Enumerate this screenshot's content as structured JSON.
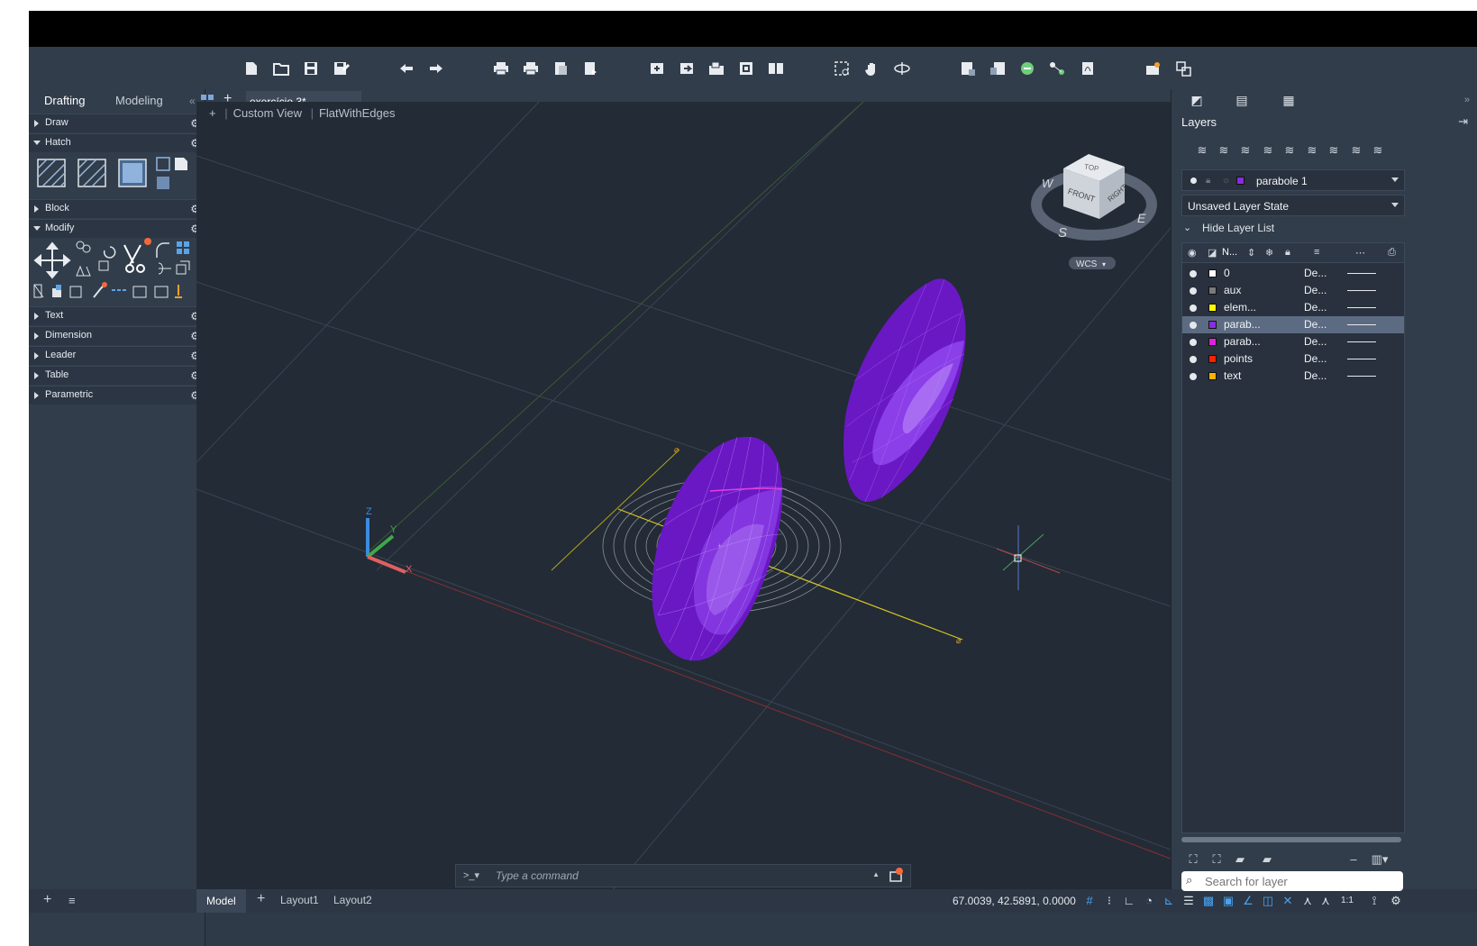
{
  "toolbar": {
    "icons": [
      "new-icon",
      "open-icon",
      "save-icon",
      "save-as-icon",
      "undo-icon",
      "redo-icon",
      "plot-icon",
      "batch-plot-icon",
      "plot-preview-icon",
      "publish-icon",
      "import-icon",
      "export-icon",
      "attach-icon",
      "xref-icon",
      "compare-icon",
      "zoom-window-icon",
      "pan-icon",
      "orbit-icon",
      "insert-icon",
      "block-editor-icon",
      "share-icon",
      "connect-icon",
      "pdf-icon",
      "render-icon",
      "settings-icon"
    ]
  },
  "left_panel": {
    "tabs": [
      "Drafting",
      "Modeling"
    ],
    "collapse": "«",
    "sections": [
      {
        "label": "Draw",
        "expanded": false
      },
      {
        "label": "Hatch",
        "expanded": true
      },
      {
        "label": "Block",
        "expanded": false
      },
      {
        "label": "Modify",
        "expanded": true
      },
      {
        "label": "Text",
        "expanded": false
      },
      {
        "label": "Dimension",
        "expanded": false
      },
      {
        "label": "Leader",
        "expanded": false
      },
      {
        "label": "Table",
        "expanded": false
      },
      {
        "label": "Parametric",
        "expanded": false
      }
    ]
  },
  "doc_tabs": {
    "active": "exercício 3*",
    "add": "+"
  },
  "viewport": {
    "plus": "+",
    "view": "Custom View",
    "visual_style": "FlatWithEdges",
    "viewcube": {
      "top": "TOP",
      "front": "FRONT",
      "right": "RIGHT",
      "w": "W",
      "s": "S",
      "e": "E",
      "wcs": "WCS"
    },
    "ucs": {
      "x": "X",
      "y": "Y",
      "z": "Z"
    }
  },
  "command_line": {
    "prompt": ">_▾",
    "placeholder": "Type a command"
  },
  "status_bar": {
    "layout_tabs": [
      "Model",
      "Layout1",
      "Layout2"
    ],
    "add": "+",
    "coords": "67.0039, 42.5891, 0.0000",
    "scale": "1:1"
  },
  "right_panel": {
    "title": "Layers",
    "current_layer": "parabole 1",
    "current_layer_color": "#8a2be2",
    "layer_state": "Unsaved Layer State",
    "hide_list": "Hide Layer List",
    "header_name": "N...",
    "layers": [
      {
        "name": "0",
        "color": "#ffffff",
        "linetype": "De...",
        "selected": false
      },
      {
        "name": "aux",
        "color": "#7a7a7a",
        "linetype": "De...",
        "selected": false
      },
      {
        "name": "elem...",
        "color": "#ffff00",
        "linetype": "De...",
        "selected": false
      },
      {
        "name": "parab...",
        "color": "#8a2be2",
        "linetype": "De...",
        "selected": true
      },
      {
        "name": "parab...",
        "color": "#e020e0",
        "linetype": "De...",
        "selected": false
      },
      {
        "name": "points",
        "color": "#ff2000",
        "linetype": "De...",
        "selected": false
      },
      {
        "name": "text",
        "color": "#ffb000",
        "linetype": "De...",
        "selected": false
      }
    ],
    "search_placeholder": "Search for layer"
  },
  "colors": {
    "accent": "#2d8ceb",
    "solid_purple": "#7b22d6"
  }
}
